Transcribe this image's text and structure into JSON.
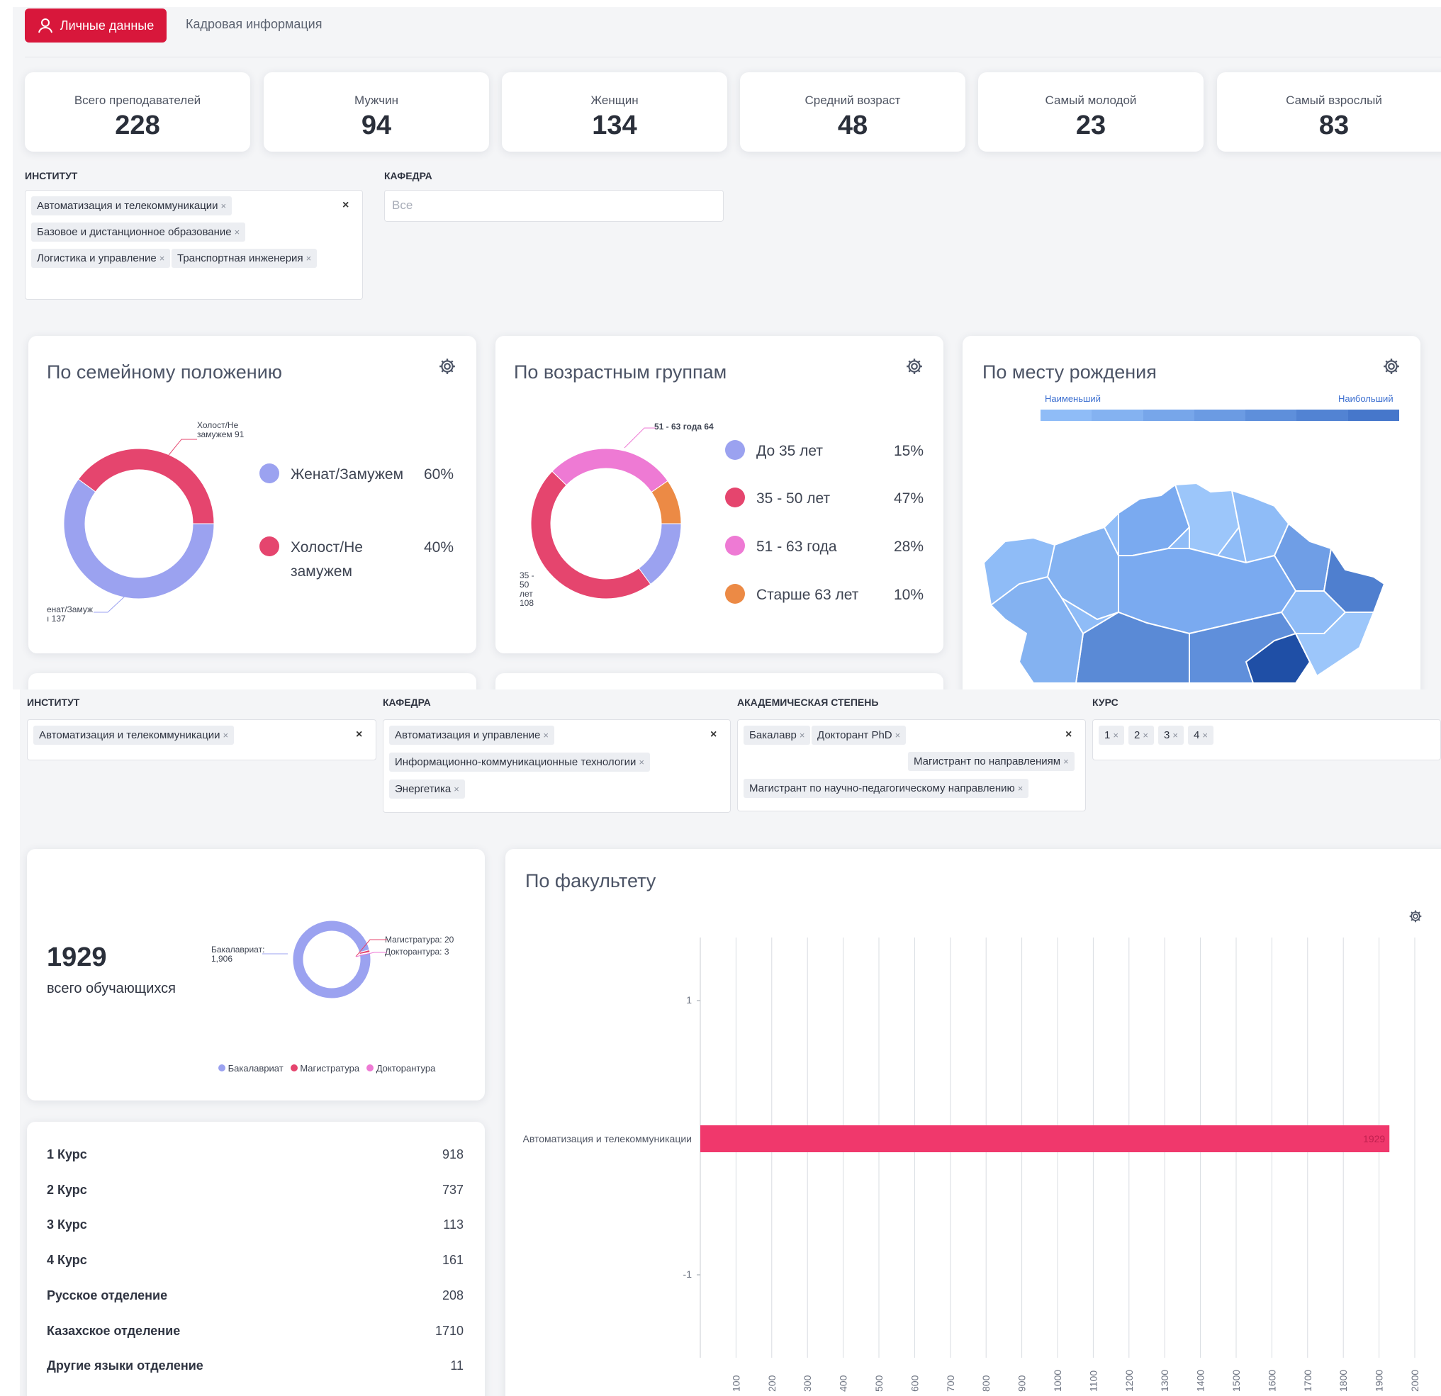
{
  "tabs": {
    "active": "Личные данные",
    "second": "Кадровая информация"
  },
  "stats": [
    {
      "label": "Всего преподавателей",
      "value": "228"
    },
    {
      "label": "Мужчин",
      "value": "94"
    },
    {
      "label": "Женщин",
      "value": "134"
    },
    {
      "label": "Средний возраст",
      "value": "48"
    },
    {
      "label": "Самый молодой",
      "value": "23"
    },
    {
      "label": "Самый взрослый",
      "value": "83"
    }
  ],
  "filters_top": {
    "institute_label": "ИНСТИТУТ",
    "institute_chips": [
      "Автоматизация и телекоммуникации",
      "Базовое и дистанционное образование",
      "Логистика и управление",
      "Транспортная инженерия"
    ],
    "department_label": "КАФЕДРА",
    "department_placeholder": "Все"
  },
  "marital": {
    "title": "По семейному положению",
    "legend": [
      {
        "label": "Женат/Замужем",
        "pct": "60%",
        "color": "#9ba2f0"
      },
      {
        "label": "Холост/Не",
        "label2": "замужем",
        "pct": "40%",
        "color": "#e5456e"
      }
    ],
    "callout_top": [
      "Холост/Не",
      "замужем 91"
    ],
    "callout_bottom": [
      "енат/Замуж",
      "ı 137"
    ]
  },
  "age": {
    "title": "По возрастным группам",
    "legend": [
      {
        "label": "До 35 лет",
        "pct": "15%",
        "color": "#9ba2f0"
      },
      {
        "label": "35 - 50 лет",
        "pct": "47%",
        "color": "#e5456e"
      },
      {
        "label": "51 - 63 года",
        "pct": "28%",
        "color": "#ee7ad4"
      },
      {
        "label": "Старше 63 лет",
        "pct": "10%",
        "color": "#ec8a45"
      }
    ],
    "callout_top": "51 - 63 года 64",
    "callout_left": [
      "35 -",
      "50",
      "лет",
      "108"
    ]
  },
  "birthplace": {
    "title": "По месту рождения",
    "min_label": "Наименьший",
    "max_label": "Наибольший"
  },
  "filters_bottom": {
    "institute_label": "ИНСТИТУТ",
    "institute_chips": [
      "Автоматизация и телекоммуникации"
    ],
    "department_label": "КАФЕДРА",
    "department_chips": [
      "Автоматизация и управление",
      "Информационно-коммуникационные технологии",
      "Энергетика"
    ],
    "degree_label": "АКАДЕМИЧЕСКАЯ СТЕПЕНЬ",
    "degree_chips": [
      "Бакалавр",
      "Докторант PhD",
      "Магистрант по направлениям",
      "Магистрант по научно-педагогическому направлению"
    ],
    "course_label": "КУРС",
    "course_chips": [
      "1",
      "2",
      "3",
      "4"
    ]
  },
  "students": {
    "total": "1929",
    "total_label": "всего обучающихся",
    "callout_bach": [
      "Бакалавриат:",
      "1,906"
    ],
    "callout_mag": "Магистратура: 20",
    "callout_doc": "Докторантура: 3",
    "legend": [
      {
        "label": "Бакалавриат",
        "color": "#9ba2f0"
      },
      {
        "label": "Магистратура",
        "color": "#e5456e"
      },
      {
        "label": "Докторантура",
        "color": "#ee7ad4"
      }
    ]
  },
  "breakdown": [
    {
      "label": "1 Курс",
      "value": "918"
    },
    {
      "label": "2 Курс",
      "value": "737"
    },
    {
      "label": "3 Курс",
      "value": "113"
    },
    {
      "label": "4 Курс",
      "value": "161"
    },
    {
      "label": "Русское отделение",
      "value": "208"
    },
    {
      "label": "Казахское отделение",
      "value": "1710"
    },
    {
      "label": "Другие языки отделение",
      "value": "11"
    }
  ],
  "chart_data": [
    {
      "type": "pie",
      "title": "По семейному положению",
      "categories": [
        "Женат/Замужем",
        "Холост/Не замужем"
      ],
      "values": [
        137,
        91
      ],
      "percent": [
        60,
        40
      ]
    },
    {
      "type": "pie",
      "title": "По возрастным группам",
      "categories": [
        "До 35 лет",
        "35 - 50 лет",
        "51 - 63 года",
        "Старше 63 лет"
      ],
      "values": [
        34,
        108,
        64,
        22
      ],
      "percent": [
        15,
        47,
        28,
        10
      ]
    },
    {
      "type": "pie",
      "title": "",
      "categories": [
        "Бакалавриат",
        "Магистратура",
        "Докторантура"
      ],
      "values": [
        1906,
        20,
        3
      ]
    },
    {
      "type": "bar",
      "title": "По факультету",
      "orientation": "horizontal",
      "categories": [
        "Автоматизация и телекоммуникации"
      ],
      "values": [
        1929
      ],
      "xlim": [
        0,
        2000
      ],
      "xticks": [
        100,
        200,
        300,
        400,
        500,
        600,
        700,
        800,
        900,
        1000,
        1100,
        1200,
        1300,
        1400,
        1500,
        1600,
        1700,
        1800,
        1900,
        2000
      ],
      "yticks": [
        1,
        -1
      ],
      "color": "#f0386c",
      "grid": true
    }
  ]
}
